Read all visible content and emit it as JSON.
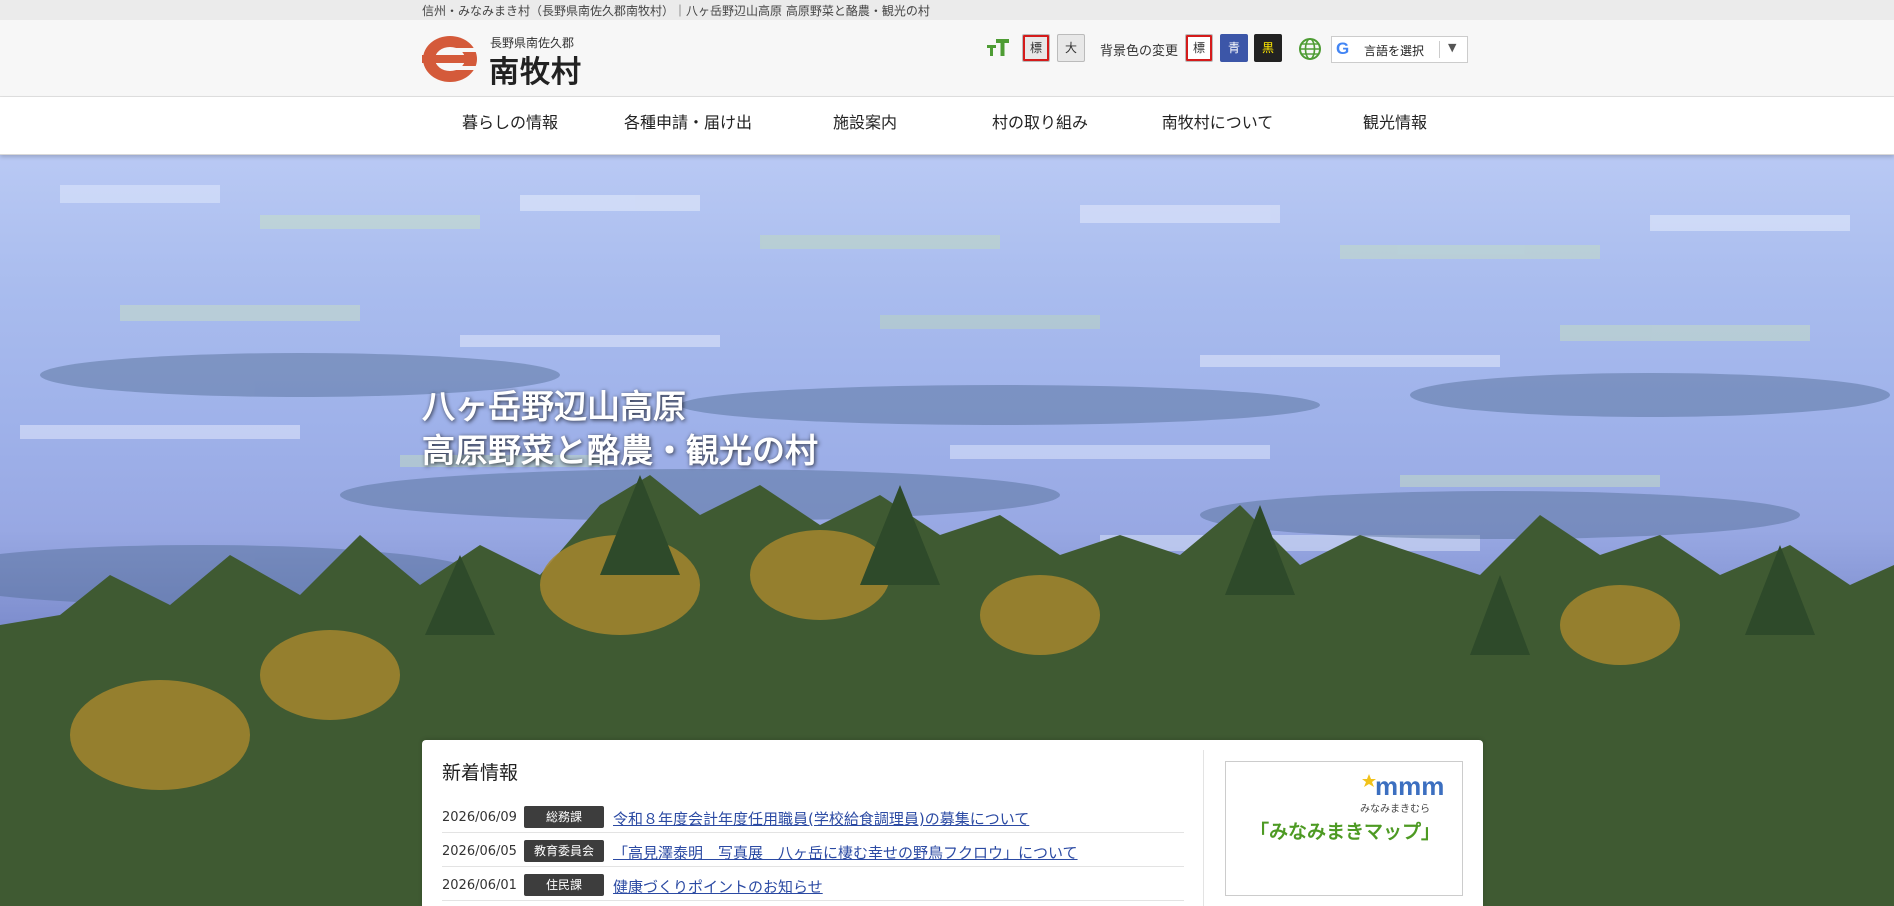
{
  "top_strip": {
    "text": "信州・みなみまき村（長野県南佐久郡南牧村）｜八ヶ岳野辺山高原 高原野菜と酪農・観光の村"
  },
  "logo": {
    "prefecture": "長野県南佐久郡",
    "village": "南牧村"
  },
  "tools": {
    "text_size_icon": "text-size-icon",
    "size_standard": "標",
    "size_large": "大",
    "bg_label": "背景色の変更",
    "bg_standard": "標",
    "bg_blue": "青",
    "bg_black": "黒",
    "globe_icon": "globe-icon",
    "language_select": "言語を選択",
    "google_letter": "G",
    "dropdown_arrow": "▼"
  },
  "nav": {
    "items": [
      {
        "label": "暮らしの情報"
      },
      {
        "label": "各種申請・届け出"
      },
      {
        "label": "施設案内"
      },
      {
        "label": "村の取り組み"
      },
      {
        "label": "南牧村について"
      },
      {
        "label": "観光情報"
      }
    ]
  },
  "hero": {
    "line1": "八ヶ岳野辺山高原",
    "line2": "高原野菜と酪農・観光の村"
  },
  "news": {
    "title": "新着情報",
    "items": [
      {
        "date": "2026/06/09",
        "dept": "総務課",
        "text": "令和８年度会計年度任用職員(学校給食調理員)の募集について"
      },
      {
        "date": "2026/06/05",
        "dept": "教育委員会",
        "text": "「高見澤泰明　写真展　八ヶ岳に棲む幸せの野鳥フクロウ」について"
      },
      {
        "date": "2026/06/01",
        "dept": "住民課",
        "text": "健康づくりポイントのお知らせ"
      }
    ]
  },
  "map_banner": {
    "logo_text": "mmm",
    "subtitle": "みなみまきむら",
    "label": "「みなみまきマップ」"
  },
  "colors": {
    "accent_red": "#d41b1b",
    "blue_bg": "#3c56a8",
    "black_bg": "#222222",
    "link": "#2b4aa3",
    "map_green": "#4d9a23",
    "logo_red": "#d45a3a"
  }
}
